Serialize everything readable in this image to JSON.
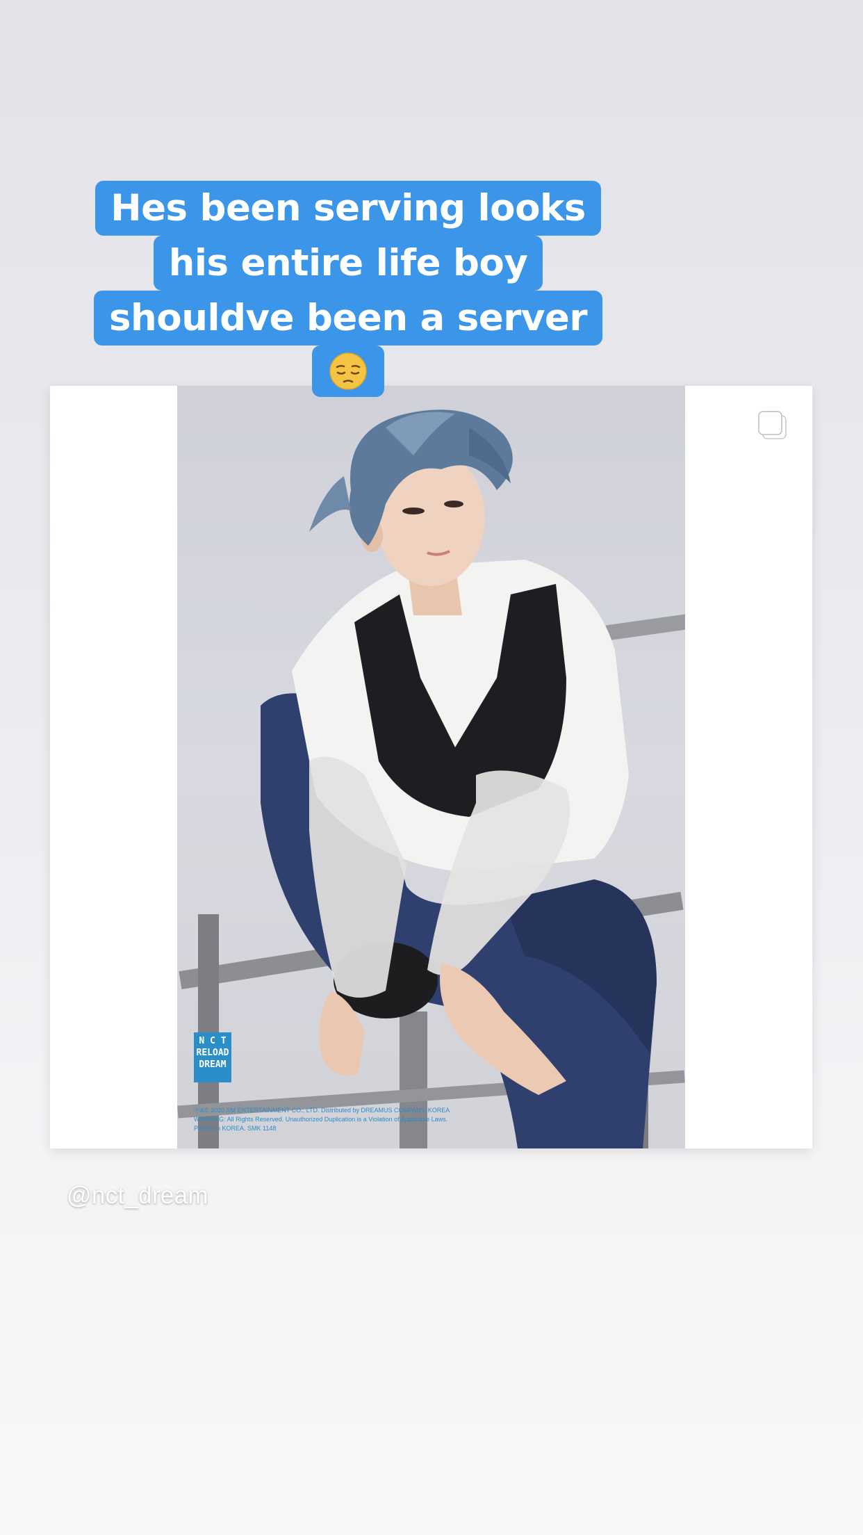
{
  "story": {
    "caption_lines": [
      "Hes been serving looks",
      "his entire life boy",
      "shouldve been a server"
    ],
    "caption_emoji": "😔",
    "caption_color": "#3b95e8",
    "mention": "@nct_dream"
  },
  "post": {
    "carousel_icon": "carousel-stack-icon",
    "album_logo_lines": [
      "N C T",
      "RELOAD",
      "DREAM"
    ],
    "copyright_lines": [
      "ⓟ&© 2020 SM ENTERTAINMENT CO., LTD. Distributed by DREAMUS COMPANY, KOREA",
      "WARNING: All Rights Reserved. Unauthorized Duplication is a Violation of Applicable Laws.",
      "Printed in KOREA. SMK 1148"
    ]
  }
}
